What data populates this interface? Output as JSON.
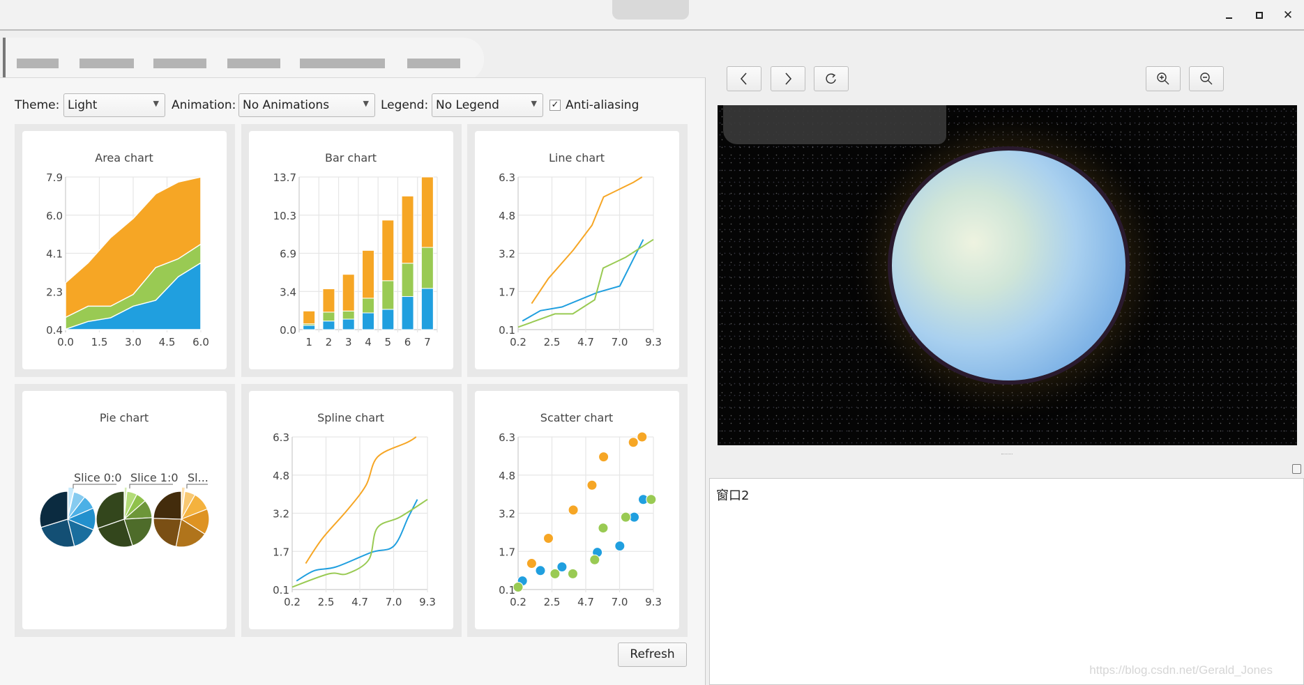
{
  "toolbar": {
    "theme_label": "Theme:",
    "theme_value": "Light",
    "animation_label": "Animation:",
    "animation_value": "No Animations",
    "legend_label": "Legend:",
    "legend_value": "No Legend",
    "antialiasing_label": "Anti-aliasing",
    "antialiasing_checked": true
  },
  "refresh_label": "Refresh",
  "viewer": {
    "text": "窗口2",
    "watermark": "https://blog.csdn.net/Gerald_Jones"
  },
  "icons": {
    "back": "chevron-left-icon",
    "forward": "chevron-right-icon",
    "reload": "reload-icon",
    "zoom_in": "zoom-in-icon",
    "zoom_out": "zoom-out-icon",
    "float": "float-window-icon"
  },
  "colors": {
    "series": [
      "#209fdf",
      "#99ca53",
      "#f6a625"
    ],
    "pie": [
      [
        "#c6e9fb",
        "#86cbf0",
        "#4cb0e6",
        "#2290cd",
        "#1a6e9e",
        "#134f74",
        "#0b2b40"
      ],
      [
        "#d6edb6",
        "#b3dc78",
        "#8fc14b",
        "#6d9639",
        "#4e6c2a",
        "#33461c",
        "#33461c"
      ],
      [
        "#fde0ad",
        "#f8c872",
        "#f4b23e",
        "#de9322",
        "#b0741b",
        "#7a4f14",
        "#432c0c"
      ]
    ]
  },
  "chart_data": [
    {
      "type": "area",
      "title": "Area chart",
      "x": [
        0,
        1,
        2,
        3,
        4,
        5,
        6
      ],
      "xlim": [
        0,
        6
      ],
      "ylim": [
        0.4,
        7.9
      ],
      "xticks": [
        "0.0",
        "1.5",
        "3.0",
        "4.5",
        "6.0"
      ],
      "yticks": [
        "0.4",
        "2.3",
        "4.1",
        "6.0",
        "7.9"
      ],
      "stacked": true,
      "series": [
        {
          "values": [
            0.42,
            0.8,
            0.98,
            1.55,
            1.84,
            3.0,
            3.68
          ]
        },
        {
          "values": [
            1.0,
            1.55,
            1.55,
            2.13,
            3.45,
            3.88,
            4.6
          ]
        },
        {
          "values": [
            2.7,
            3.68,
            4.92,
            5.86,
            7.07,
            7.65,
            7.9
          ]
        }
      ]
    },
    {
      "type": "bar",
      "title": "Bar chart",
      "categories": [
        "1",
        "2",
        "3",
        "4",
        "5",
        "6",
        "7"
      ],
      "ylim": [
        0,
        13.7
      ],
      "yticks": [
        "0.0",
        "3.4",
        "6.9",
        "10.3",
        "13.7"
      ],
      "stacked": true,
      "series": [
        {
          "values": [
            0.38,
            0.77,
            0.94,
            1.5,
            1.82,
            2.97,
            3.7
          ]
        },
        {
          "values": [
            0.14,
            0.8,
            0.73,
            1.32,
            2.57,
            2.99,
            3.68
          ]
        },
        {
          "values": [
            1.15,
            2.09,
            3.29,
            4.29,
            5.44,
            6.03,
            6.32
          ]
        }
      ]
    },
    {
      "type": "line",
      "title": "Line chart",
      "xlim": [
        0.2,
        9.3
      ],
      "ylim": [
        0.1,
        6.3
      ],
      "xticks": [
        "0.2",
        "2.5",
        "4.7",
        "7.0",
        "9.3"
      ],
      "yticks": [
        "0.1",
        "1.7",
        "3.2",
        "4.8",
        "6.3"
      ],
      "series": [
        {
          "x": [
            0.49,
            1.7,
            3.15,
            5.53,
            7.04,
            8.01,
            8.62
          ],
          "y": [
            0.45,
            0.87,
            1.02,
            1.61,
            1.87,
            3.04,
            3.76
          ]
        },
        {
          "x": [
            0.2,
            2.68,
            3.88,
            5.35,
            5.92,
            7.44,
            9.3
          ],
          "y": [
            0.2,
            0.74,
            0.74,
            1.31,
            2.6,
            3.04,
            3.76
          ]
        },
        {
          "x": [
            1.11,
            2.24,
            3.91,
            5.17,
            5.95,
            7.95,
            8.54
          ],
          "y": [
            1.16,
            2.18,
            3.33,
            4.34,
            5.49,
            6.08,
            6.3
          ]
        }
      ]
    },
    {
      "type": "pie",
      "title": "Pie chart",
      "labels": [
        "Slice 0:0",
        "Slice 1:0",
        "Sl..."
      ],
      "series": [
        {
          "values": [
            0.45,
            0.87,
            1.02,
            1.61,
            1.87,
            3.04,
            3.76
          ]
        },
        {
          "values": [
            0.2,
            0.74,
            0.74,
            1.31,
            2.6,
            3.04,
            3.76
          ]
        },
        {
          "values": [
            0.3,
            0.9,
            1.6,
            2.2,
            2.8,
            3.3,
            3.6
          ]
        }
      ]
    },
    {
      "type": "spline",
      "title": "Spline chart",
      "xlim": [
        0.2,
        9.3
      ],
      "ylim": [
        0.1,
        6.3
      ],
      "xticks": [
        "0.2",
        "2.5",
        "4.7",
        "7.0",
        "9.3"
      ],
      "yticks": [
        "0.1",
        "1.7",
        "3.2",
        "4.8",
        "6.3"
      ],
      "series": [
        {
          "x": [
            0.49,
            1.7,
            3.15,
            5.53,
            7.04,
            8.01,
            8.62
          ],
          "y": [
            0.45,
            0.87,
            1.02,
            1.61,
            1.87,
            3.04,
            3.76
          ]
        },
        {
          "x": [
            0.2,
            2.68,
            3.88,
            5.35,
            5.92,
            7.44,
            9.3
          ],
          "y": [
            0.2,
            0.74,
            0.74,
            1.31,
            2.6,
            3.04,
            3.76
          ]
        },
        {
          "x": [
            1.11,
            2.24,
            3.91,
            5.17,
            5.95,
            7.95,
            8.54
          ],
          "y": [
            1.16,
            2.18,
            3.33,
            4.34,
            5.49,
            6.08,
            6.3
          ]
        }
      ]
    },
    {
      "type": "scatter",
      "title": "Scatter chart",
      "xlim": [
        0.2,
        9.3
      ],
      "ylim": [
        0.1,
        6.3
      ],
      "xticks": [
        "0.2",
        "2.5",
        "4.7",
        "7.0",
        "9.3"
      ],
      "yticks": [
        "0.1",
        "1.7",
        "3.2",
        "4.8",
        "6.3"
      ],
      "series": [
        {
          "x": [
            0.49,
            1.7,
            3.15,
            5.53,
            7.04,
            8.01,
            8.62
          ],
          "y": [
            0.45,
            0.87,
            1.02,
            1.61,
            1.87,
            3.04,
            3.76
          ]
        },
        {
          "x": [
            0.2,
            2.68,
            3.88,
            5.35,
            5.92,
            7.44,
            9.15
          ],
          "y": [
            0.2,
            0.74,
            0.74,
            1.31,
            2.6,
            3.04,
            3.76
          ]
        },
        {
          "x": [
            1.11,
            2.24,
            3.91,
            5.17,
            5.95,
            7.95,
            8.54
          ],
          "y": [
            1.16,
            2.18,
            3.33,
            4.34,
            5.49,
            6.08,
            6.3
          ]
        }
      ]
    }
  ]
}
